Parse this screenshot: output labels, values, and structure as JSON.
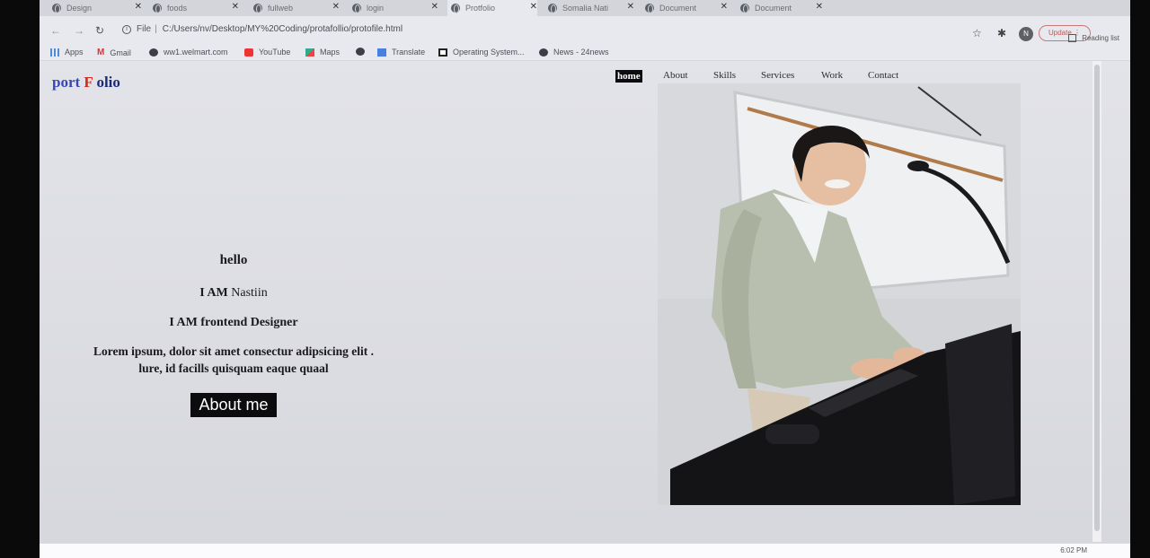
{
  "browser": {
    "tabs": [
      {
        "label": "Design"
      },
      {
        "label": "foods"
      },
      {
        "label": "fullweb"
      },
      {
        "label": "login"
      },
      {
        "label": "Protfolio"
      },
      {
        "label": "Somalia Nati"
      },
      {
        "label": "Document"
      },
      {
        "label": "Document"
      }
    ],
    "address": {
      "scheme": "File",
      "url": "C:/Users/nv/Desktop/MY%20Coding/protafollio/protofile.html"
    },
    "profile_initial": "N",
    "update_label": "Update",
    "reading_list": "Reading list",
    "bookmarks": [
      {
        "label": "Apps",
        "icon": "apps-grid-icon"
      },
      {
        "label": "Gmail",
        "icon": "gmail-icon"
      },
      {
        "label": "ww1.welmart.com",
        "icon": "globe-icon"
      },
      {
        "label": "YouTube",
        "icon": "youtube-icon"
      },
      {
        "label": "Maps",
        "icon": "maps-icon"
      },
      {
        "label": "",
        "icon": "globe-icon"
      },
      {
        "label": "Translate",
        "icon": "translate-icon"
      },
      {
        "label": "Operating System...",
        "icon": "os-icon"
      },
      {
        "label": "News - 24news",
        "icon": "globe-icon"
      }
    ]
  },
  "site": {
    "logo": {
      "part1": "port ",
      "part2": "F",
      "part3": " olio"
    },
    "nav": {
      "home": "home",
      "about": "About",
      "skills": "Skills",
      "services": "Services",
      "work": "Work",
      "contact": "Contact"
    },
    "hero": {
      "greeting": "hello",
      "iam_prefix": "I AM",
      "name": " Nastiin",
      "role": "I AM frontend Designer",
      "lorem_line1": "Lorem ipsum, dolor sit amet consectur adipsicing elit .",
      "lorem_line2": "lure, id facills quisquam eaque quaal",
      "button": "About me"
    }
  },
  "taskbar": {
    "clock": "6:02 PM"
  },
  "colors": {
    "logo_blue": "#3a46b6",
    "logo_red": "#d02b1c",
    "button_bg": "#0c0c0f"
  }
}
